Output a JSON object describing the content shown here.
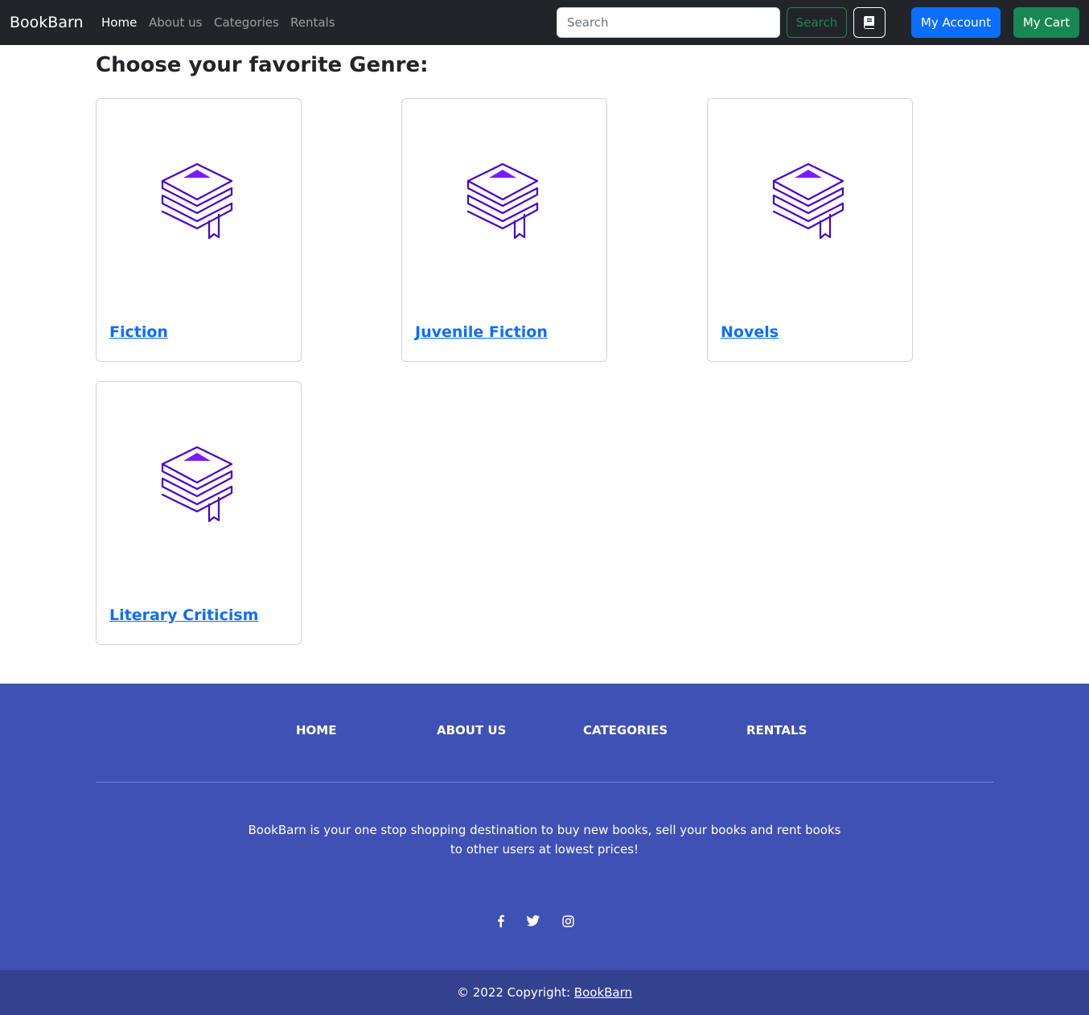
{
  "navbar": {
    "brand": "BookBarn",
    "links": [
      {
        "label": "Home",
        "active": true
      },
      {
        "label": "About us"
      },
      {
        "label": "Categories"
      },
      {
        "label": "Rentals"
      }
    ],
    "search_placeholder": "Search",
    "search_button": "Search",
    "book_icon": "book-icon",
    "account_button": "My Account",
    "cart_button": "My Cart"
  },
  "main": {
    "title": "Choose your favorite Genre:",
    "image_icon": "book-stack-icon",
    "genres": [
      {
        "label": "Fiction"
      },
      {
        "label": "Juvenile Fiction"
      },
      {
        "label": "Novels"
      },
      {
        "label": "Literary Criticism"
      }
    ]
  },
  "footer": {
    "links": [
      {
        "label": "HOME"
      },
      {
        "label": "ABOUT US"
      },
      {
        "label": "CATEGORIES"
      },
      {
        "label": "RENTALS"
      }
    ],
    "description": "BookBarn is your one stop shopping destination to buy new books, sell your books and rent books to other users at lowest prices!",
    "social": [
      "facebook-icon",
      "twitter-icon",
      "instagram-icon"
    ],
    "copyright_prefix": "© 2022 Copyright: ",
    "copyright_link": "BookBarn"
  },
  "colors": {
    "navbar_bg": "#212529",
    "primary": "#0d6efd",
    "success": "#198754",
    "footer_bg": "#3f51b5",
    "copyright_bg": "#33418f",
    "icon_purple": "#4b00c8",
    "icon_fill": "#7c1aff"
  }
}
